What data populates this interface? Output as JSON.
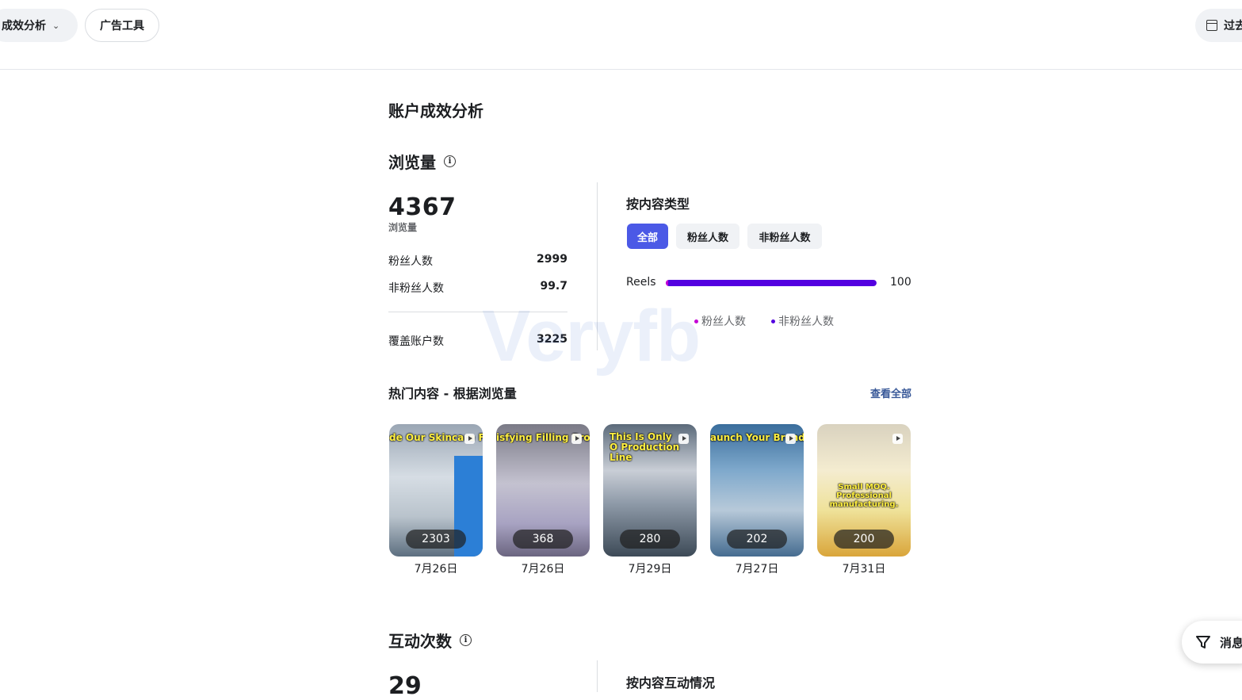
{
  "topbar": {
    "performance_label": "成效分析",
    "ad_tools_label": "广告工具",
    "date_label": "过去"
  },
  "main": {
    "title": "账户成效分析",
    "views": {
      "title": "浏览量",
      "total": "4367",
      "total_label": "浏览量",
      "rows": [
        {
          "label": "粉丝人数",
          "value": "2999"
        },
        {
          "label": "非粉丝人数",
          "value": "99.7"
        }
      ],
      "reach": {
        "label": "覆盖账户数",
        "value": "3225"
      }
    },
    "by_content_type": {
      "title": "按内容类型",
      "tabs": [
        "全部",
        "粉丝人数",
        "非粉丝人数"
      ],
      "active_tab": 0,
      "bar": {
        "label": "Reels",
        "value": "100",
        "fraction": 1.0,
        "fan_fraction": 0.01
      },
      "legend": [
        {
          "label": "粉丝人数",
          "color": "#c400d6"
        },
        {
          "label": "非粉丝人数",
          "color": "#5300e0"
        }
      ]
    },
    "top_content": {
      "title": "热门内容 - 根据浏览量",
      "see_all": "查看全部",
      "items": [
        {
          "overlay_text": "de Our Skincare Fact",
          "count": "2303",
          "date": "7月26日"
        },
        {
          "overlay_text": "isfying Filling Proc",
          "count": "368",
          "date": "7月26日"
        },
        {
          "overlay_text": "This Is Only O Production Line",
          "count": "280",
          "date": "7月29日"
        },
        {
          "overlay_text": "aunch Your Brand – MOQ",
          "count": "202",
          "date": "7月27日"
        },
        {
          "overlay_text": "Small MOQ. Professional manufacturing.",
          "count": "200",
          "date": "7月31日"
        }
      ]
    },
    "interactions": {
      "title": "互动次数",
      "total": "29",
      "by_content_title": "按内容互动情况"
    }
  },
  "watermark": "Veryfb",
  "fab": {
    "label": "消息"
  }
}
